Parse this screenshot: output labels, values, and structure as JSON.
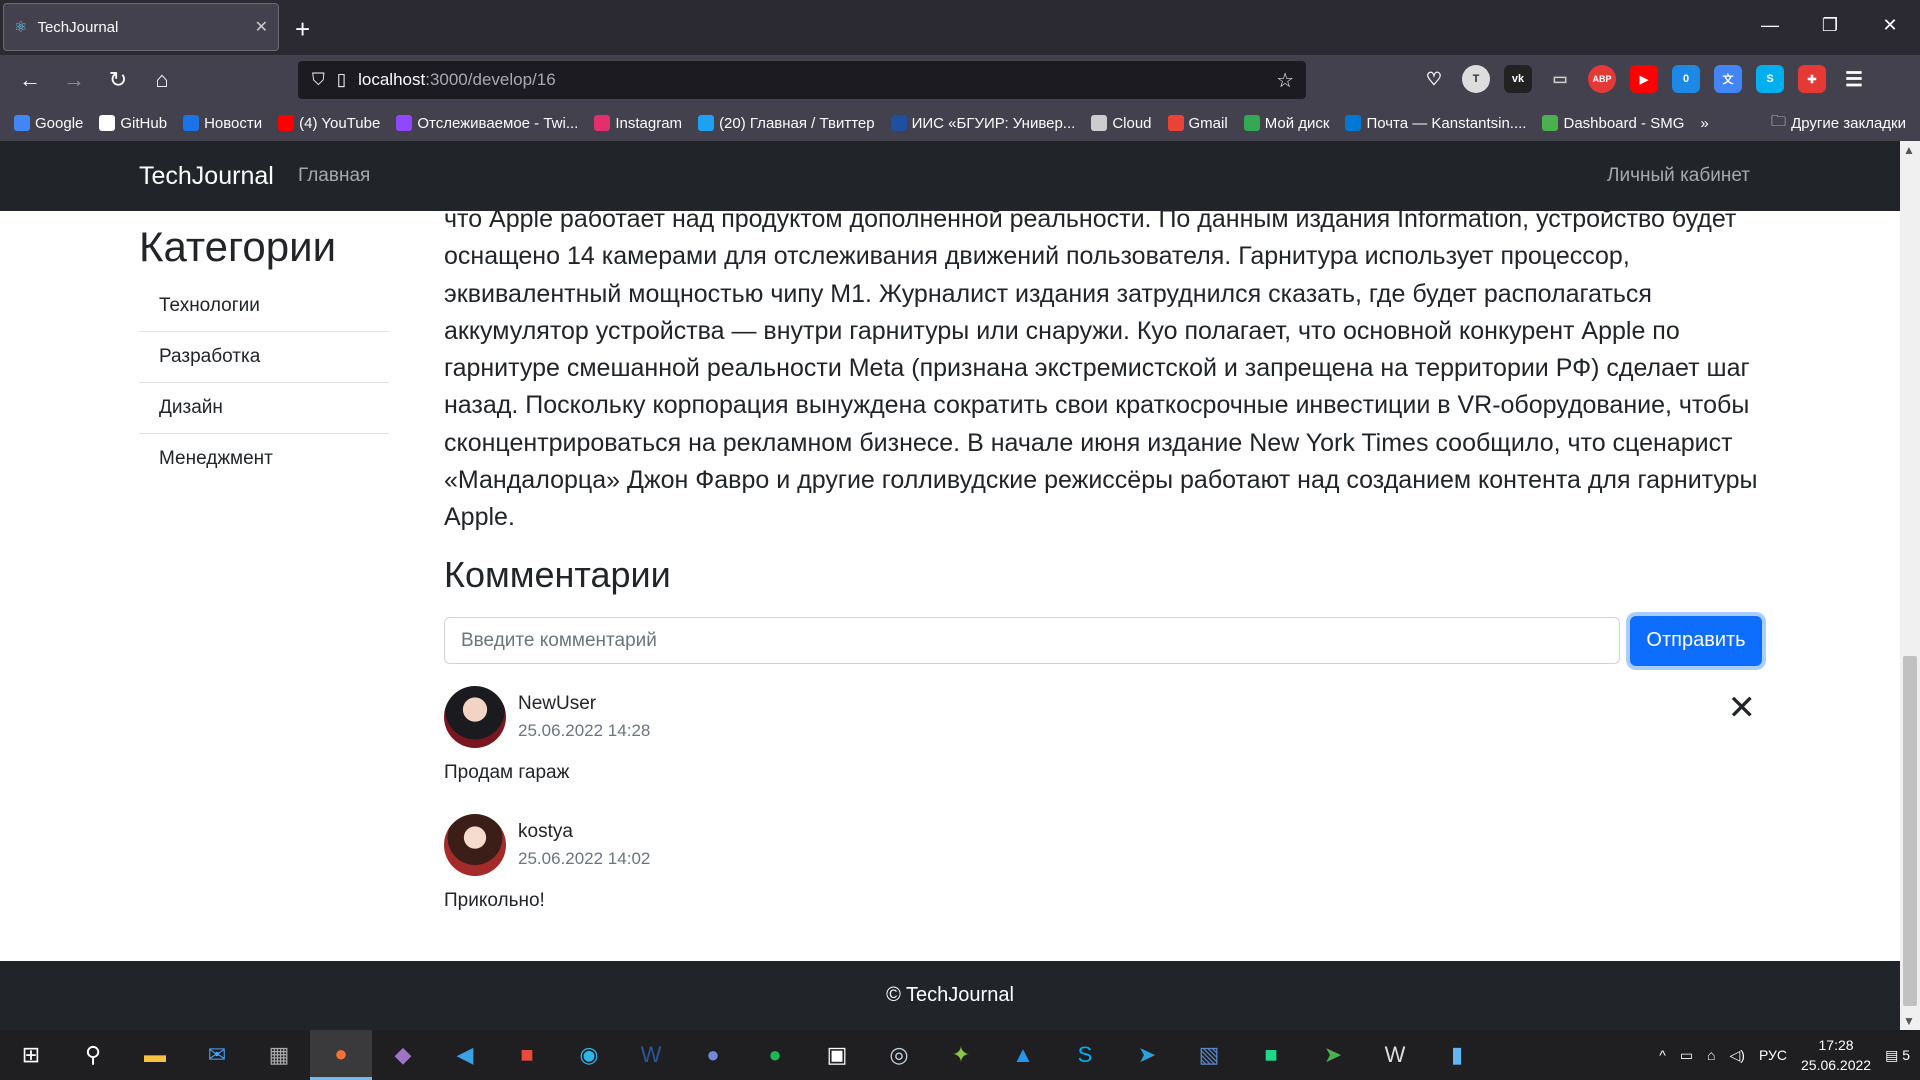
{
  "browser": {
    "tab_title": "TechJournal",
    "url_host": "localhost",
    "url_path": ":3000/develop/16",
    "bookmarks": [
      {
        "label": "Google",
        "color": "#4285f4"
      },
      {
        "label": "GitHub",
        "color": "#ffffff"
      },
      {
        "label": "Новости",
        "color": "#1a73e8"
      },
      {
        "label": "(4) YouTube",
        "color": "#ff0000"
      },
      {
        "label": "Отслеживаемое - Twi...",
        "color": "#9146ff"
      },
      {
        "label": "Instagram",
        "color": "#e1306c"
      },
      {
        "label": "(20) Главная / Твиттер",
        "color": "#1da1f2"
      },
      {
        "label": "ИИС «БГУИР: Универ...",
        "color": "#1e4fa0"
      },
      {
        "label": "Cloud",
        "color": "#cccccc"
      },
      {
        "label": "Gmail",
        "color": "#ea4335"
      },
      {
        "label": "Мой диск",
        "color": "#34a853"
      },
      {
        "label": "Почта — Kanstantsin....",
        "color": "#0078d4"
      },
      {
        "label": "Dashboard - SMG",
        "color": "#4caf50"
      }
    ],
    "other_bookmarks": "Другие закладки",
    "ext_badge": "0",
    "ext_abp": "ABP"
  },
  "site": {
    "brand": "TechJournal",
    "nav_home": "Главная",
    "nav_cabinet": "Личный кабинет",
    "sidebar_title": "Категории",
    "categories": [
      "Технологии",
      "Разработка",
      "Дизайн",
      "Менеджмент"
    ],
    "article_text": "что Apple работает над продуктом дополненной реальности.  По данным издания Information, устройство будет оснащено 14 камерами для отслеживания движений пользователя. Гарнитура использует процессор, эквивалентный мощностью чипу M1. Журналист издания затруднился сказать, где будет располагаться аккумулятор устройства — внутри гарнитуры или снаружи.  Куо полагает, что основной конкурент Apple по гарнитуре смешанной реальности Meta (признана экстремистской и запрещена на территории РФ) сделает шаг назад. Поскольку корпорация вынуждена сократить свои краткосрочные инвестиции в VR-оборудование, чтобы сконцентрироваться на рекламном бизнесе.  В начале июня издание New York Times сообщило, что сценарист «Мандалорца» Джон Фавро и другие голливудские режиссёры работают над созданием контента для гарнитуры Apple.",
    "comments_title": "Комментарии",
    "comment_placeholder": "Введите комментарий",
    "send_label": "Отправить",
    "comments": [
      {
        "user": "NewUser",
        "date": "25.06.2022 14:28",
        "text": "Продам гараж"
      },
      {
        "user": "kostya",
        "date": "25.06.2022 14:02",
        "text": "Прикольно!"
      }
    ],
    "footer": "© TechJournal"
  },
  "taskbar": {
    "lang": "РУС",
    "time": "17:28",
    "date": "25.06.2022",
    "notif_count": "5"
  },
  "colors": {
    "primary": "#0d6efd",
    "navbar": "#212529"
  }
}
